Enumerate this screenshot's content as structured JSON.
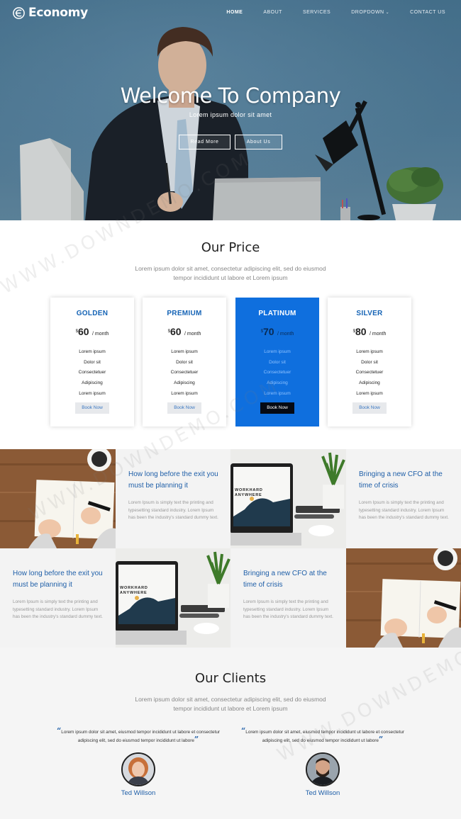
{
  "brand": {
    "name": "Economy"
  },
  "nav": {
    "items": [
      {
        "label": "HOME",
        "active": true
      },
      {
        "label": "ABOUT"
      },
      {
        "label": "SERVICES"
      },
      {
        "label": "DROPDOWN"
      },
      {
        "label": "CONTACT US"
      }
    ]
  },
  "hero": {
    "title": "Welcome To Company",
    "subtitle": "Lorem ipsum dolor sit amet",
    "read_more": "Read More",
    "about_us": "About Us"
  },
  "price": {
    "title": "Our Price",
    "description": "Lorem ipsum dolor sit amet, consectetur adipiscing elit, sed do eiusmod tempor incididunt ut labore et Lorem ipsum",
    "plans": [
      {
        "name": "GOLDEN",
        "currency": "$",
        "amount": "60",
        "period": "/ month",
        "features": [
          "Lorem ipsum",
          "Dolor sit",
          "Consectetuer",
          "Adipiscing",
          "Lorem ipsum"
        ],
        "button": "Book Now"
      },
      {
        "name": "PREMIUM",
        "currency": "$",
        "amount": "60",
        "period": "/ month",
        "features": [
          "Lorem ipsum",
          "Dolor sit",
          "Consectetuer",
          "Adipiscing",
          "Lorem ipsum"
        ],
        "button": "Book Now"
      },
      {
        "name": "PLATINUM",
        "currency": "$",
        "amount": "70",
        "period": "/ month",
        "features": [
          "Lorem ipsum",
          "Dolor sit",
          "Consectetuer",
          "Adipiscing",
          "Lorem ipsum"
        ],
        "button": "Book Now"
      },
      {
        "name": "SILVER",
        "currency": "$",
        "amount": "80",
        "period": "/ month",
        "features": [
          "Lorem ipsum",
          "Dolor sit",
          "Consectetuer",
          "Adipiscing",
          "Lorem ipsum"
        ],
        "button": "Book Now"
      }
    ]
  },
  "features": [
    {
      "title": "How long before the exit you must be planning it",
      "body": "Lorem Ipsum is simply text the printing and typesetting standard industry. Lorem Ipsum has been the industry's standard dummy text."
    },
    {
      "title": "Bringing a new CFO at the time of crisis",
      "body": "Lorem Ipsum is simply text the printing and typesetting standard industry. Lorem Ipsum has been the industry's standard dummy text."
    },
    {
      "title": "How long before the exit you must be planning it",
      "body": "Lorem Ipsum is simply text the printing and typesetting standard industry. Lorem Ipsum has been the industry's standard dummy text."
    },
    {
      "title": "Bringing a new CFO at the time of crisis",
      "body": "Lorem Ipsum is simply text the printing and typesetting standard industry. Lorem Ipsum has been the industry's standard dummy text."
    }
  ],
  "laptop_text": "WORKHARD ANYWHERE",
  "clients": {
    "title": "Our Clients",
    "description": "Lorem ipsum dolor sit amet, consectetur adipiscing elit, sed do eiusmod tempor incididunt ut labore et Lorem ipsum",
    "testimonials": [
      {
        "quote": "Lorem ipsum dolor sit amet, eiusmod tempor incididunt ut labore et consectetur adipiscing elit, sed do eiusmod tempor incididunt ut labore",
        "name": "Ted Willson"
      },
      {
        "quote": "Lorem ipsum dolor sit amet, eiusmod tempor incididunt ut labore et consectetur adipiscing elit, sed do eiusmod tempor incididunt ut labore",
        "name": "Ted Willson"
      }
    ]
  },
  "watermark": "WWW.DOWNDEMO.COM",
  "colors": {
    "accent": "#1f5fa8",
    "featured": "#0f6fde",
    "hero": "#5a88a6"
  }
}
